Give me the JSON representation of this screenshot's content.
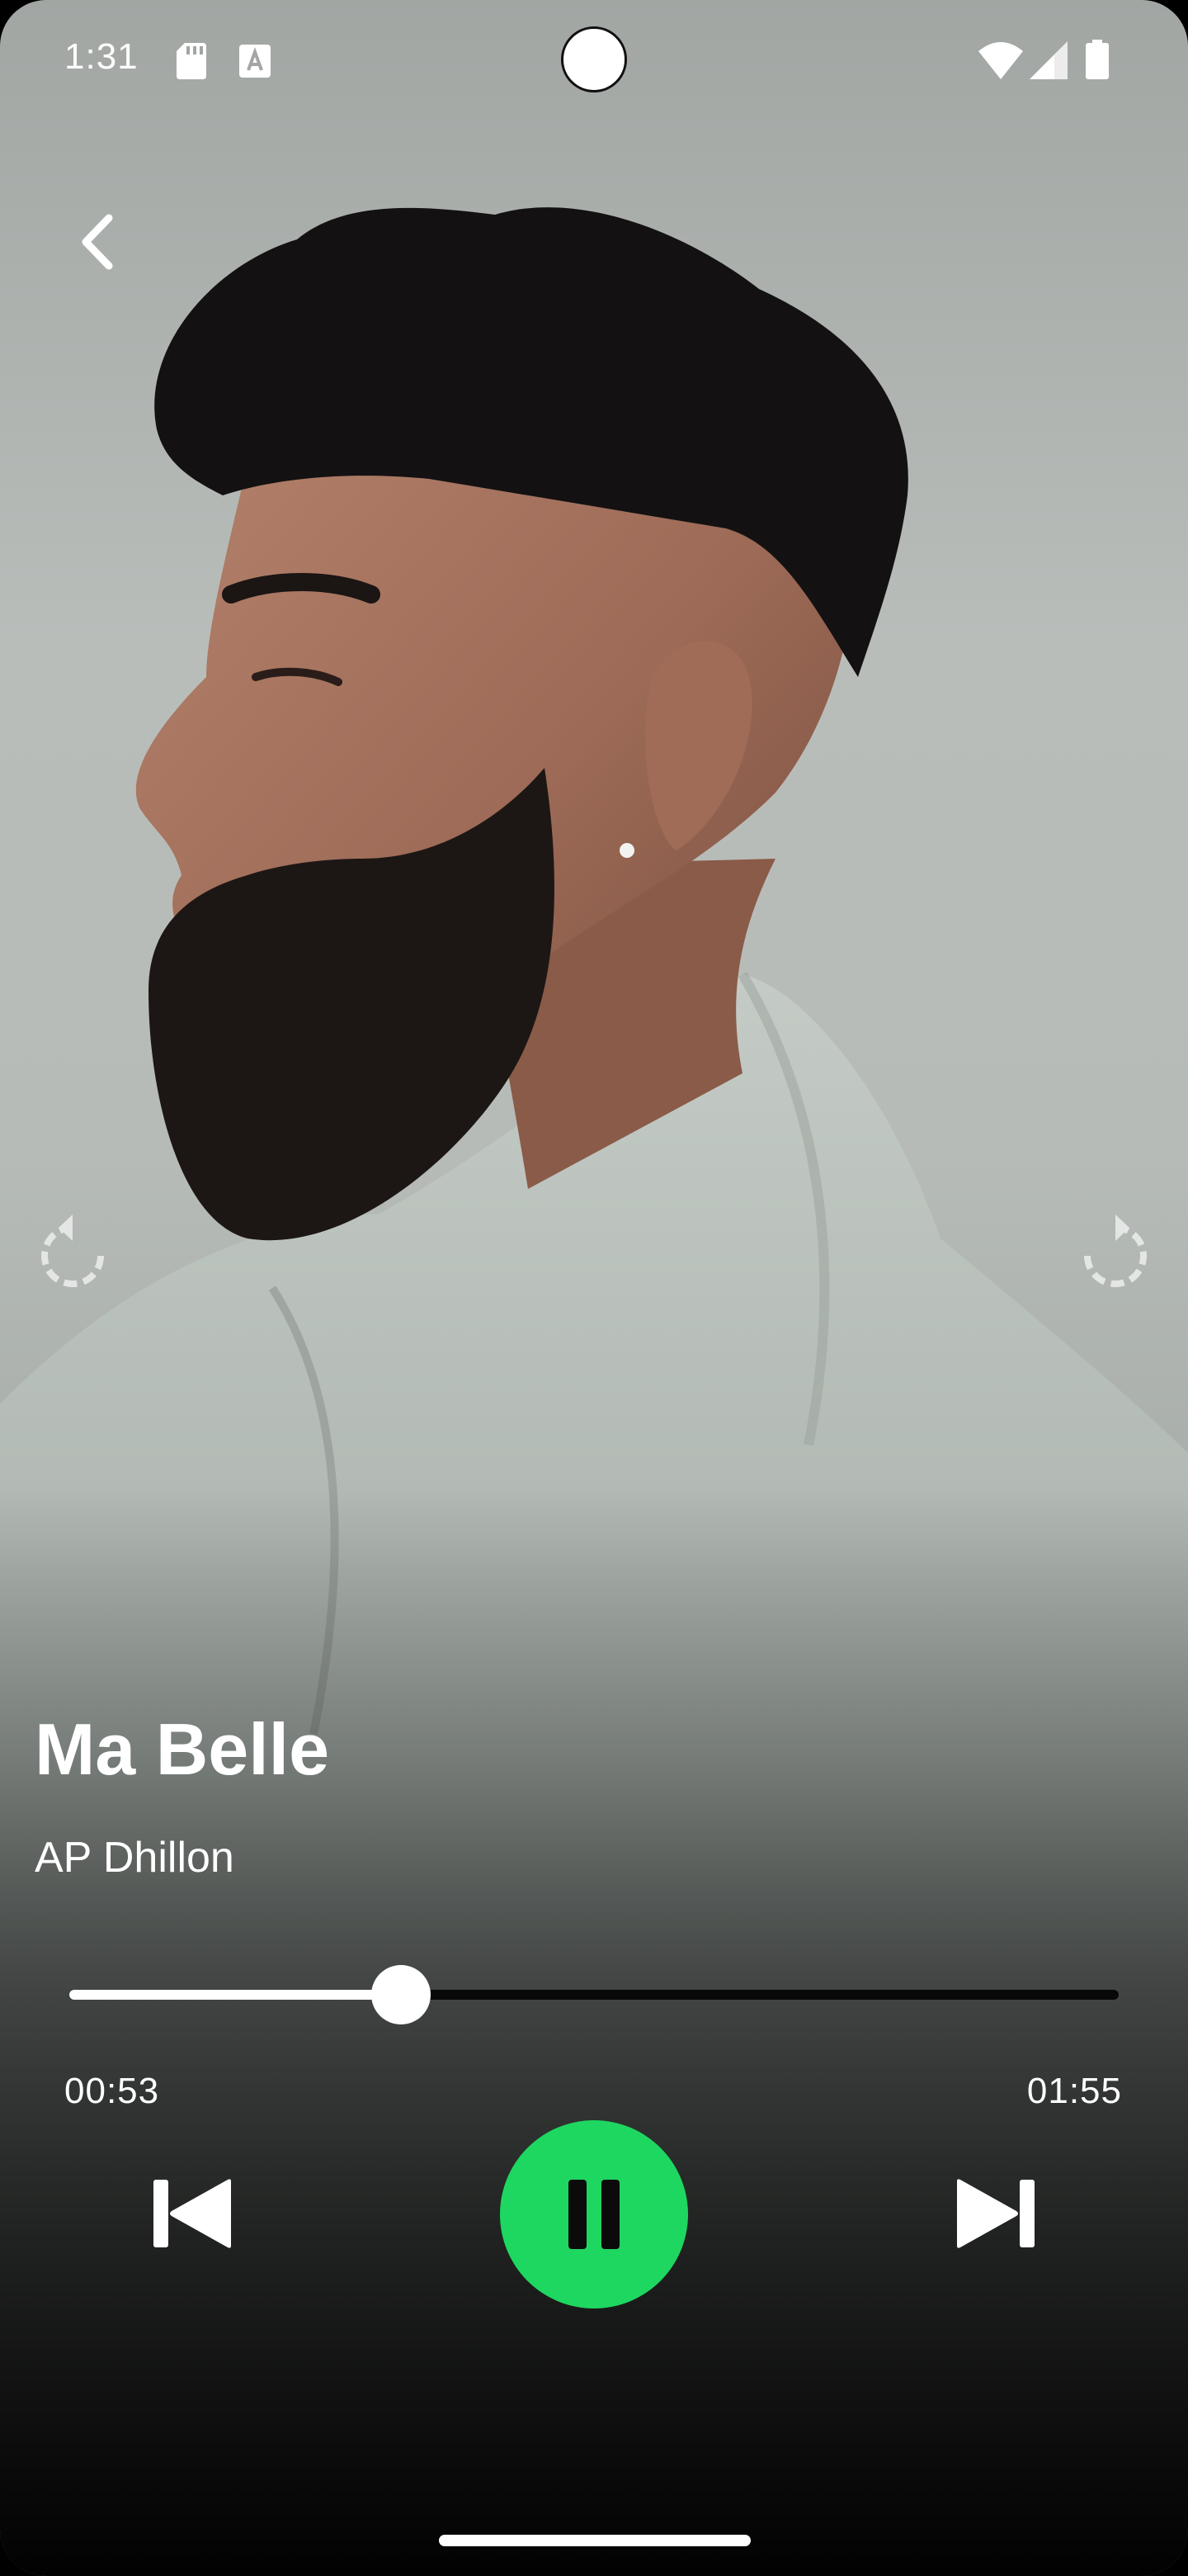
{
  "status_bar": {
    "time": "1:31",
    "icons": [
      "sd-card-icon",
      "text-a-icon",
      "wifi-icon",
      "cellular-signal-icon",
      "battery-icon"
    ]
  },
  "player": {
    "song_title": "Ma Belle",
    "artist": "AP Dhillon",
    "elapsed": "00:53",
    "duration": "01:55",
    "progress_fraction": 0.316,
    "is_playing": true,
    "accent_color": "#1ed760"
  },
  "icons": {
    "back": "chevron-left-icon",
    "rewind": "replay-icon",
    "forward": "forward-icon",
    "previous": "skip-previous-icon",
    "play_pause": "pause-icon",
    "next": "skip-next-icon"
  }
}
